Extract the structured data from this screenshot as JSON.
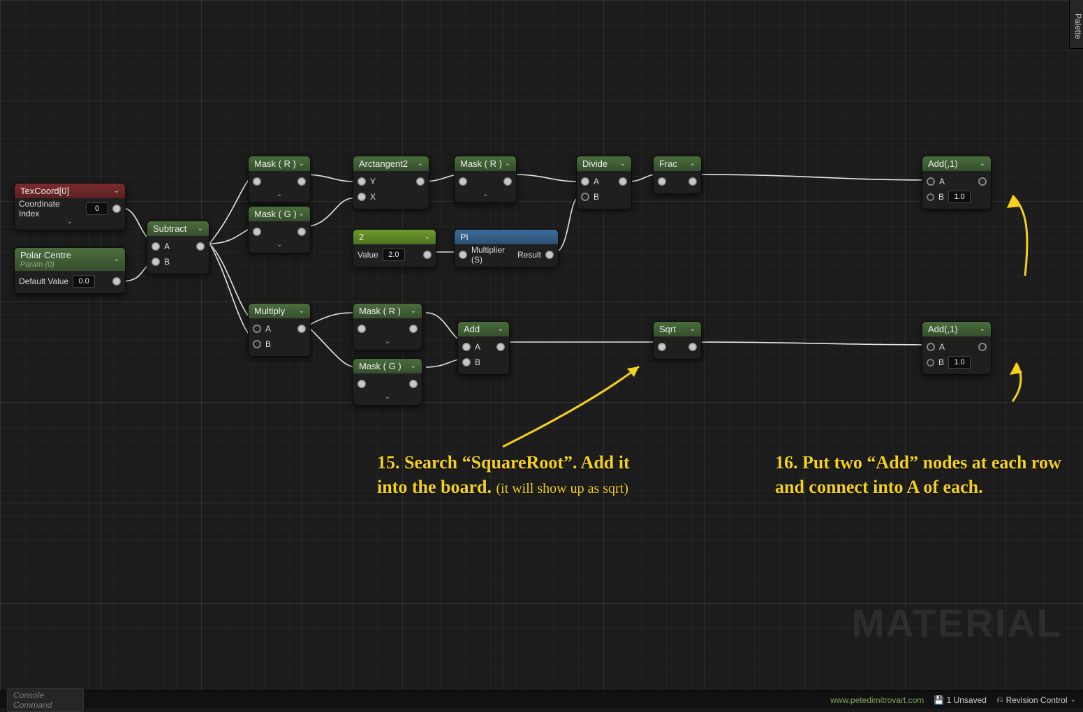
{
  "watermark": "MATERIAL",
  "palette_tab": "Palette",
  "statusbar": {
    "console_placeholder": "Console Command",
    "website": "www.petedimitrovart.com",
    "unsaved": "1 Unsaved",
    "revision_control": "Revision Control"
  },
  "annotations": {
    "a15_main": "15. Search “SquareRoot”. Add it into the board.",
    "a15_sub": "(it will show up as sqrt)",
    "a16": "16. Put two “Add” nodes at each row and connect into A of each."
  },
  "nodes": {
    "texcoord": {
      "title": "TexCoord[0]",
      "param": "Coordinate Index",
      "value": "0"
    },
    "polar": {
      "title": "Polar Centre",
      "subtitle": "Param (0)",
      "param": "Default Value",
      "value": "0.0"
    },
    "subtract": {
      "title": "Subtract",
      "inA": "A",
      "inB": "B"
    },
    "maskR1": {
      "title": "Mask ( R )"
    },
    "maskG1": {
      "title": "Mask ( G )"
    },
    "arctan": {
      "title": "Arctangent2",
      "inY": "Y",
      "inX": "X"
    },
    "maskR2": {
      "title": "Mask ( R )"
    },
    "const2": {
      "title": "2",
      "param": "Value",
      "value": "2.0"
    },
    "pi": {
      "title": "Pi",
      "inLabel": "Multiplier (S)",
      "outLabel": "Result"
    },
    "divide": {
      "title": "Divide",
      "inA": "A",
      "inB": "B"
    },
    "frac": {
      "title": "Frac"
    },
    "multiply": {
      "title": "Multiply",
      "inA": "A",
      "inB": "B"
    },
    "maskR3": {
      "title": "Mask ( R )"
    },
    "maskG3": {
      "title": "Mask ( G )"
    },
    "add_mid": {
      "title": "Add",
      "inA": "A",
      "inB": "B"
    },
    "sqrt": {
      "title": "Sqrt"
    },
    "add_top": {
      "title": "Add(,1)",
      "inA": "A",
      "inB": "B",
      "valB": "1.0"
    },
    "add_bot": {
      "title": "Add(,1)",
      "inA": "A",
      "inB": "B",
      "valB": "1.0"
    }
  }
}
